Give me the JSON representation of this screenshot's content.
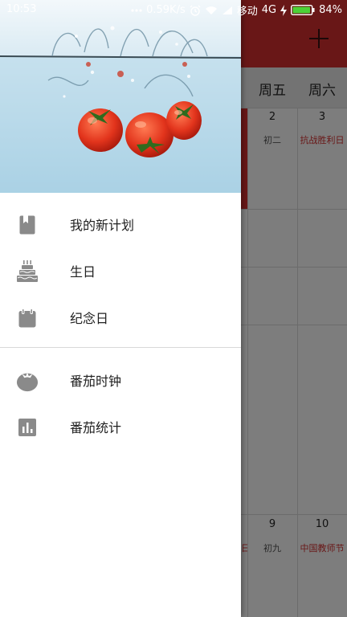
{
  "status_bar": {
    "time": "10:53",
    "net_speed": "0.59K/s",
    "carrier": "移动",
    "network": "4G",
    "battery": "84%",
    "icons": [
      "dots-icon",
      "alarm-icon",
      "wifi-icon",
      "signal-icon",
      "charging-icon",
      "battery-icon"
    ]
  },
  "background": {
    "weekdays": [
      "周五",
      "周六"
    ],
    "cells_row1": [
      {
        "date": "2",
        "lunar": "初二",
        "holiday": false
      },
      {
        "date": "3",
        "lunar": "抗战胜利日",
        "holiday": true
      }
    ],
    "cells_row2": [
      {
        "date": "9",
        "lunar": "初九",
        "holiday": false
      },
      {
        "date": "10",
        "lunar": "中国教师节",
        "holiday": true
      }
    ],
    "partial_holiday_fragment": "日",
    "toolbar_color": "#d32f2f"
  },
  "drawer": {
    "header_image": "tomatoes-splashing-into-water",
    "menu_primary": [
      {
        "label": "我的新计划",
        "icon": "plan-bookmark-icon"
      },
      {
        "label": "生日",
        "icon": "birthday-cake-icon"
      },
      {
        "label": "纪念日",
        "icon": "calendar-icon"
      }
    ],
    "menu_secondary": [
      {
        "label": "番茄时钟",
        "icon": "tomato-clock-icon"
      },
      {
        "label": "番茄统计",
        "icon": "bar-chart-icon"
      }
    ]
  }
}
